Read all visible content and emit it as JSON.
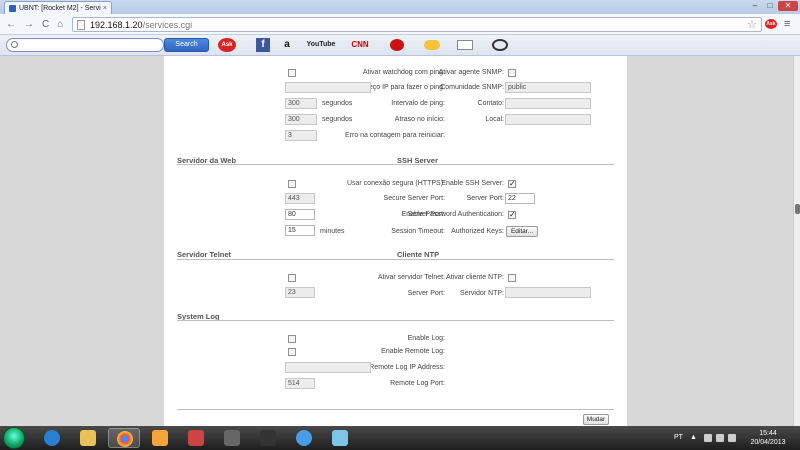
{
  "browser": {
    "tab_title": "UBNT: [Rocket M2] - Servi",
    "tab_close": "×",
    "url_host": "192.168.1.20",
    "url_path": "/services.cgi",
    "win_min": "–",
    "win_max": "□",
    "win_close": "✕",
    "back": "←",
    "forward": "→",
    "reload": "C",
    "home": "⌂",
    "star": "☆",
    "menu": "≡"
  },
  "askbar": {
    "search_placeholder": "",
    "search_button": "Search",
    "ask_logo": "Ask",
    "icons": [
      "facebook-icon",
      "amazon-icon",
      "youtube-icon",
      "cnn-icon",
      "angry-birds-icon",
      "weather-icon",
      "mail-icon",
      "radio-icon"
    ],
    "facebook": "f",
    "amazon": "a",
    "youtube": "YouTube",
    "cnn": "CNN"
  },
  "ping": {
    "watchdog_label": "Ativar watchdog com ping:",
    "ip_label": "Endereço IP para fazer o ping:",
    "interval_label": "Intervalo de ping:",
    "interval_value": "300",
    "interval_unit": "segundos",
    "delay_label": "Atraso no início:",
    "delay_value": "300",
    "delay_unit": "segundos",
    "errors_label": "Erro na contagem para reiniciar:",
    "errors_value": "3"
  },
  "snmp": {
    "enable_label": "Ativar agente SNMP:",
    "community_label": "Comunidade SNMP:",
    "community_value": "public",
    "contact_label": "Contato:",
    "location_label": "Local:"
  },
  "web": {
    "title": "Servidor da Web",
    "https_label": "Usar conexão segura (HTTPS):",
    "secure_port_label": "Secure Server Port:",
    "secure_port_value": "443",
    "port_label": "Server Port:",
    "port_value": "80",
    "timeout_label": "Session Timeout:",
    "timeout_value": "15",
    "timeout_unit": "minutes"
  },
  "ssh": {
    "title": "SSH Server",
    "enable_label": "Enable SSH Server:",
    "port_label": "Server Port:",
    "port_value": "22",
    "password_label": "Enable Password Authentication:",
    "keys_label": "Authorized Keys:",
    "edit_button": "Editar..."
  },
  "telnet": {
    "title": "Servidor Telnet",
    "enable_label": "Ativar servidor Telnet:",
    "port_label": "Server Port:",
    "port_value": "23"
  },
  "ntp": {
    "title": "Cliente NTP",
    "enable_label": "Ativar cliente NTP:",
    "server_label": "Servidor NTP:"
  },
  "syslog": {
    "title": "System Log",
    "enable_label": "Enable Log:",
    "remote_label": "Enable Remote Log:",
    "ip_label": "Remote Log IP Address:",
    "port_label": "Remote Log Port:",
    "port_value": "514"
  },
  "change_button": "Mudar",
  "checks": {
    "checked": "✓",
    "unchecked": ""
  },
  "taskbar": {
    "lang": "PT",
    "time": "15:44",
    "date": "20/04/2013"
  }
}
